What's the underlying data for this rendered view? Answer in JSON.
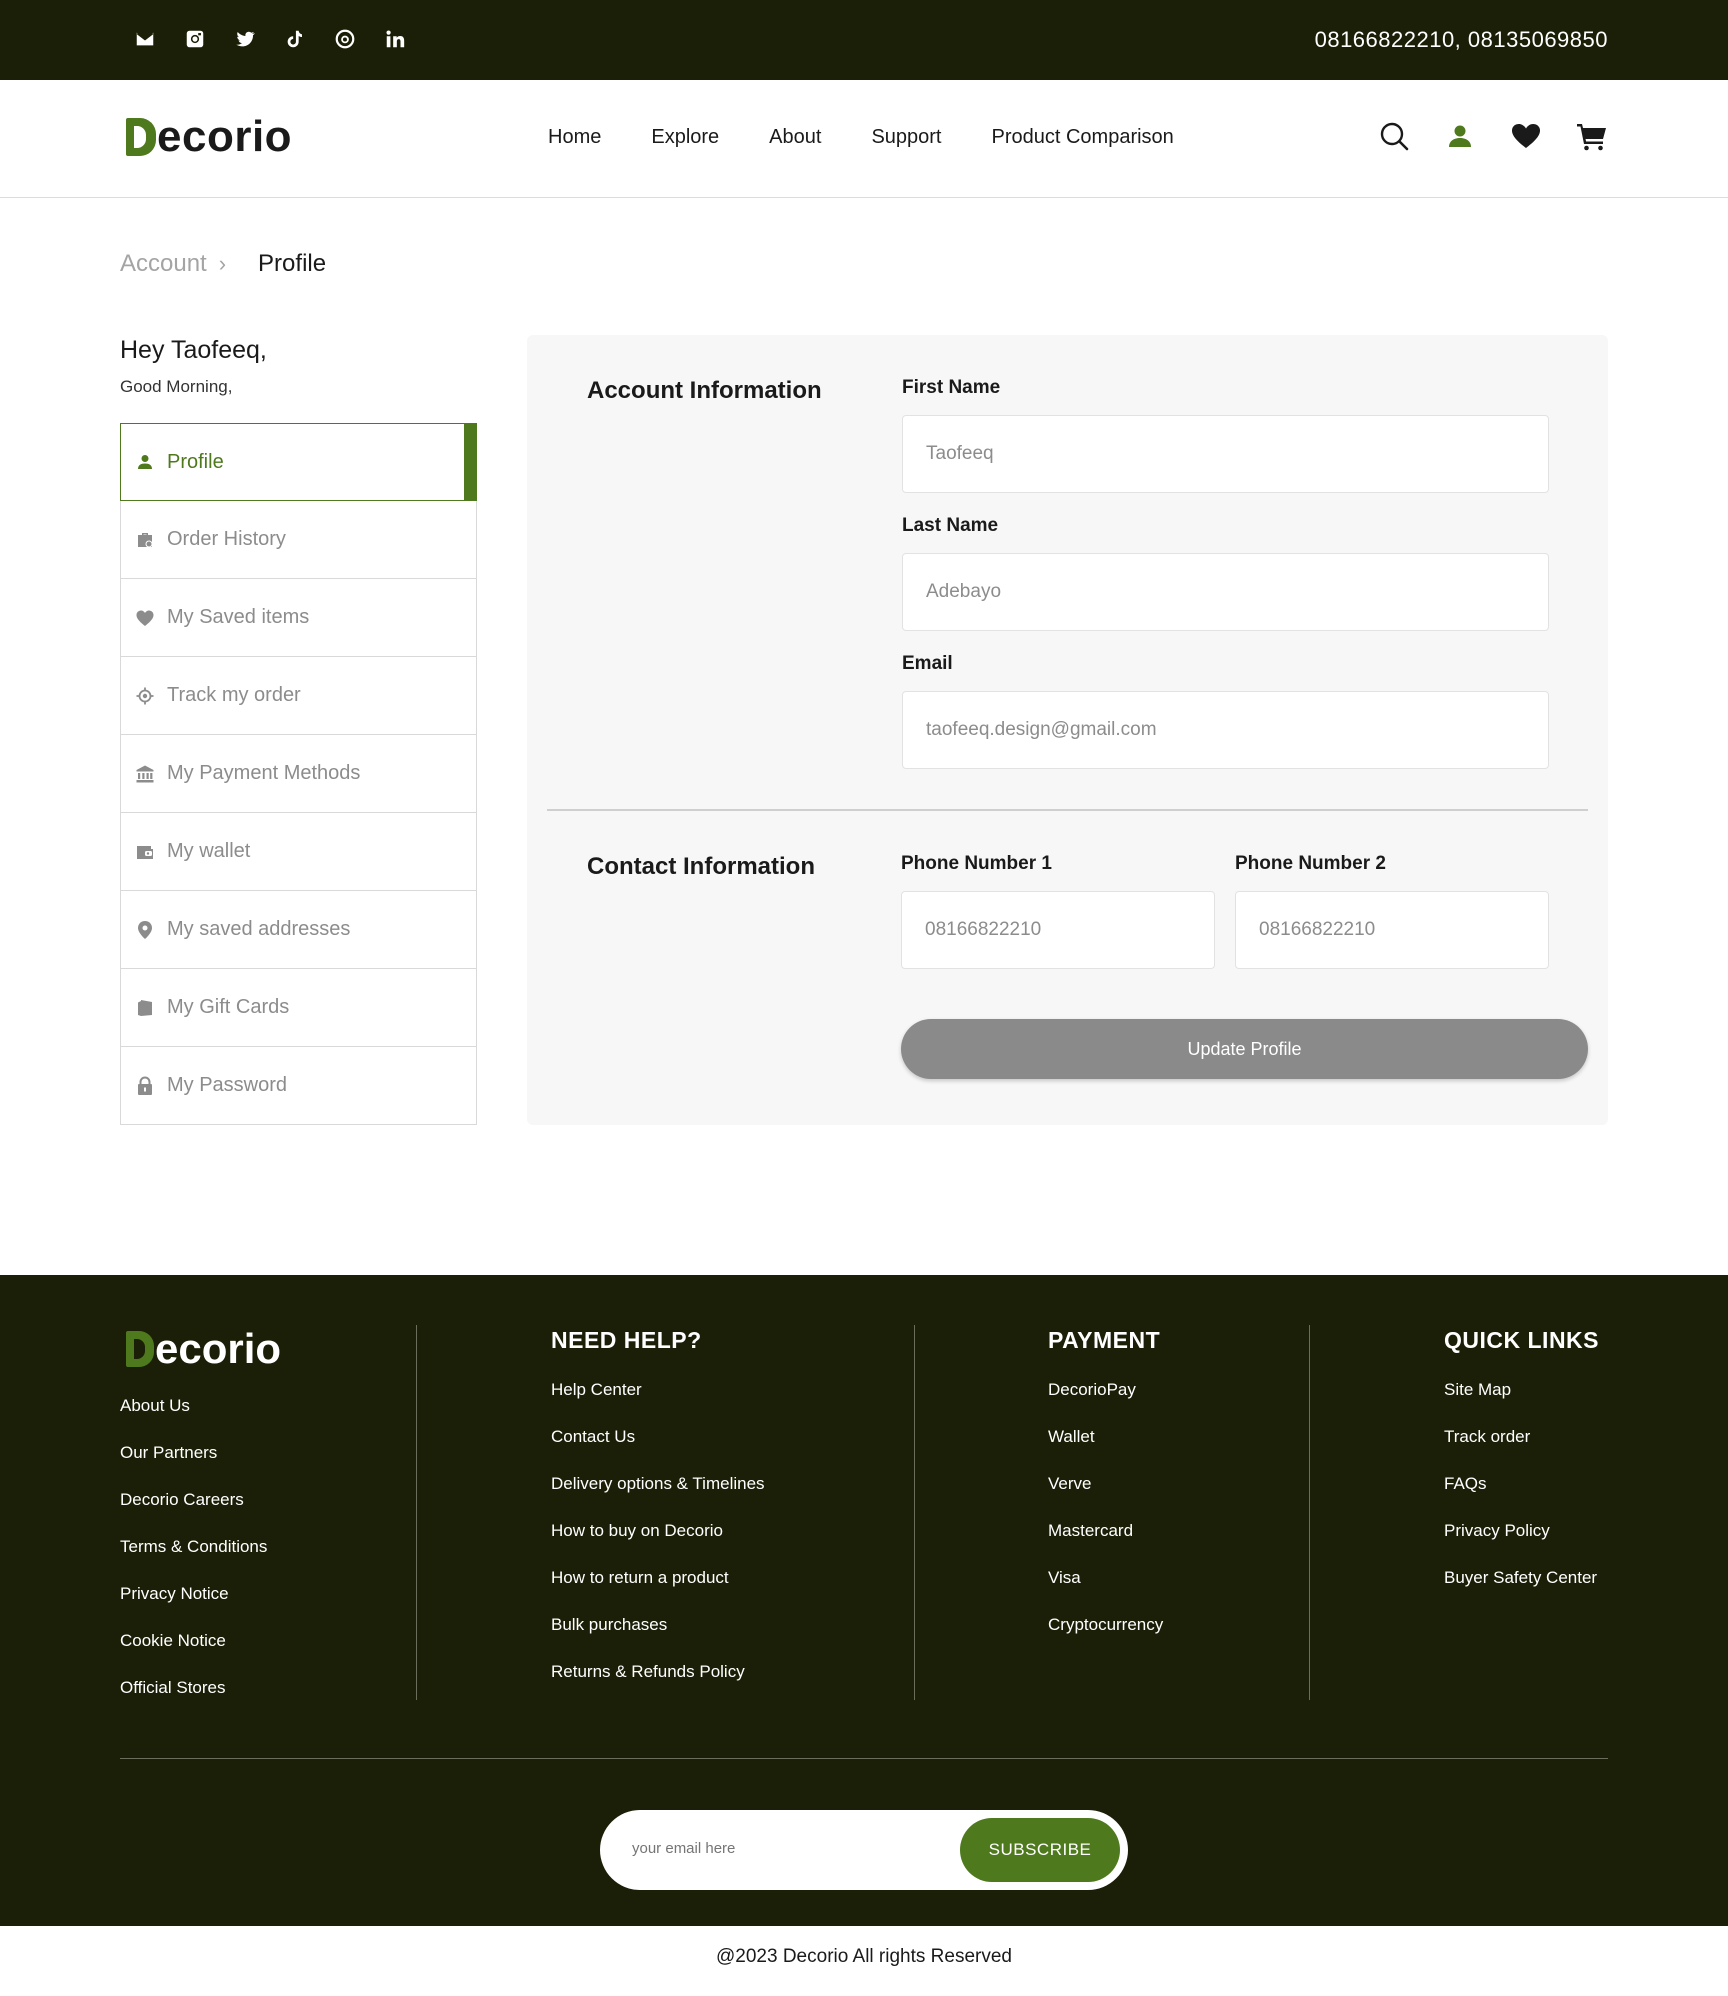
{
  "topbar": {
    "social_icons": [
      "mail-icon",
      "instagram-icon",
      "twitter-icon",
      "tiktok-icon",
      "threads-icon",
      "linkedin-icon"
    ],
    "phones": "08166822210,  08135069850"
  },
  "header": {
    "logo_text": "ecorio",
    "nav": [
      "Home",
      "Explore",
      "About",
      "Support",
      "Product Comparison"
    ],
    "icons": [
      "search-icon",
      "user-icon",
      "heart-icon",
      "cart-icon"
    ]
  },
  "breadcrumb": {
    "parent": "Account",
    "separator": "›",
    "current": "Profile"
  },
  "greeting": {
    "hello": "Hey Taofeeq,",
    "sub": "Good Morning,"
  },
  "menu": [
    {
      "label": "Profile",
      "icon": "user-icon",
      "active": true
    },
    {
      "label": "Order History",
      "icon": "briefcase-icon"
    },
    {
      "label": "My Saved items",
      "icon": "heart-icon"
    },
    {
      "label": "Track my order",
      "icon": "crosshair-icon"
    },
    {
      "label": "My Payment Methods",
      "icon": "bank-icon"
    },
    {
      "label": "My wallet",
      "icon": "wallet-icon"
    },
    {
      "label": "My saved addresses",
      "icon": "location-pin-icon"
    },
    {
      "label": "My Gift Cards",
      "icon": "gift-card-icon"
    },
    {
      "label": "My Password",
      "icon": "lock-icon"
    }
  ],
  "account": {
    "title": "Account Information",
    "first_name_label": "First Name",
    "first_name": "Taofeeq",
    "last_name_label": "Last Name",
    "last_name": "Adebayo",
    "email_label": "Email",
    "email": "taofeeq.design@gmail.com"
  },
  "contact": {
    "title": "Contact Information",
    "phone1_label": "Phone Number 1",
    "phone1": "08166822210",
    "phone2_label": "Phone Number 2",
    "phone2": "08166822210"
  },
  "update_button": "Update Profile",
  "footer": {
    "logo_text": "ecorio",
    "about_links": [
      "About Us",
      "Our Partners",
      "Decorio Careers",
      "Terms & Conditions",
      "Privacy Notice",
      "Cookie Notice",
      "Official Stores"
    ],
    "help_title": "NEED HELP?",
    "help_links": [
      "Help Center",
      "Contact Us",
      "Delivery options & Timelines",
      "How to buy on Decorio",
      "How to return a product",
      "Bulk purchases",
      "Returns & Refunds Policy"
    ],
    "payment_title": "PAYMENT",
    "payment_links": [
      "DecorioPay",
      "Wallet",
      "Verve",
      "Mastercard",
      "Visa",
      "Cryptocurrency"
    ],
    "quick_title": "QUICK LINKS",
    "quick_links": [
      "Site Map",
      "Track order",
      "FAQs",
      "Privacy Policy",
      "Buyer Safety Center"
    ],
    "email_placeholder": "your email here",
    "subscribe": "SUBSCRIBE"
  },
  "copyright": "@2023 Decorio All rights Reserved",
  "colors": {
    "brand_green": "#4e7a1d",
    "dark_bg": "#1b1f07",
    "button_gray": "#8a8a8a"
  }
}
